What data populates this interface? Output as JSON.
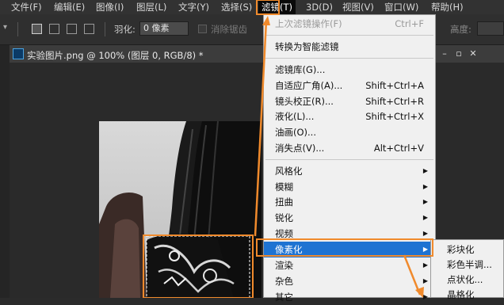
{
  "menubar": {
    "items": [
      "文件(F)",
      "编辑(E)",
      "图像(I)",
      "图层(L)",
      "文字(Y)",
      "选择(S)",
      "滤镜(T)",
      "3D(D)",
      "视图(V)",
      "窗口(W)",
      "帮助(H)"
    ],
    "active": "滤镜(T)"
  },
  "options": {
    "feather_label": "羽化:",
    "feather_value": "0 像素",
    "antialias_label": "消除锯齿",
    "height_label": "高度:"
  },
  "document": {
    "title": "实验图片.png @ 100% (图层 0, RGB/8) *",
    "ps_icon": "Ps"
  },
  "filter_menu": {
    "last_filter": {
      "label": "上次滤镜操作(F)",
      "shortcut": "Ctrl+F"
    },
    "convert_smart": "转换为智能滤镜",
    "group2": [
      {
        "label": "滤镜库(G)...",
        "shortcut": ""
      },
      {
        "label": "自适应广角(A)...",
        "shortcut": "Shift+Ctrl+A"
      },
      {
        "label": "镜头校正(R)...",
        "shortcut": "Shift+Ctrl+R"
      },
      {
        "label": "液化(L)...",
        "shortcut": "Shift+Ctrl+X"
      },
      {
        "label": "油画(O)...",
        "shortcut": ""
      },
      {
        "label": "消失点(V)...",
        "shortcut": "Alt+Ctrl+V"
      }
    ],
    "group3": [
      "风格化",
      "模糊",
      "扭曲",
      "锐化",
      "视频",
      "像素化",
      "渲染",
      "杂色",
      "其它"
    ],
    "highlighted": "像素化",
    "arrow": "▶"
  },
  "pixelate_submenu": [
    "彩块化",
    "彩色半调...",
    "点状化...",
    "晶格化"
  ],
  "window_controls": {
    "minimize": "–",
    "restore": "▫",
    "close": "✕"
  },
  "colors": {
    "accent_orange": "#f08a2c",
    "highlight_blue": "#1e73d2"
  }
}
